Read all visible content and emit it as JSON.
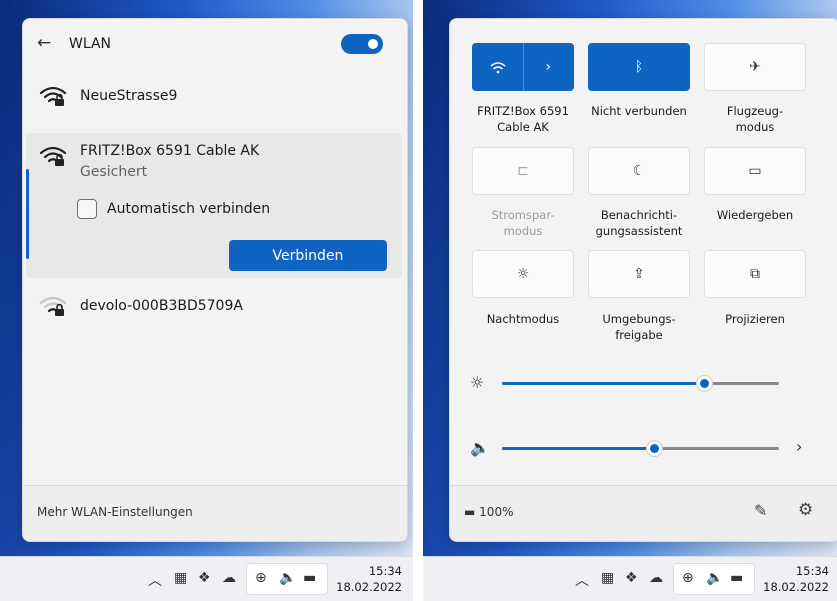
{
  "wlan": {
    "title": "WLAN",
    "back_icon": "←",
    "networks": [
      {
        "name": "NeueStrasse9",
        "status": ""
      },
      {
        "name": "FRITZ!Box 6591 Cable AK",
        "status": "Gesichert"
      },
      {
        "name": "devolo-000B3BD5709A",
        "status": ""
      }
    ],
    "auto_connect_label": "Automatisch verbinden",
    "connect_button": "Verbinden",
    "footer_link": "Mehr WLAN-Einstellungen"
  },
  "quick_settings": {
    "tiles": [
      {
        "icon": "wifi-icon",
        "label": "FRITZ!Box 6591\nCable AK",
        "state": "on"
      },
      {
        "icon": "bluetooth-icon",
        "label": "Nicht verbunden",
        "state": "on"
      },
      {
        "icon": "airplane-icon",
        "label": "Flugzeug-\nmodus",
        "state": "off"
      },
      {
        "icon": "battery-saver-icon",
        "label": "Stromspar-\nmodus",
        "state": "disabled"
      },
      {
        "icon": "moon-icon",
        "label": "Benachrichti-\ngungsassistent",
        "state": "off"
      },
      {
        "icon": "cast-icon",
        "label": "Wiedergeben",
        "state": "off"
      },
      {
        "icon": "night-light-icon",
        "label": "Nachtmodus",
        "state": "off"
      },
      {
        "icon": "share-icon",
        "label": "Umgebungs-\nfreigabe",
        "state": "off"
      },
      {
        "icon": "project-icon",
        "label": "Projizieren",
        "state": "off"
      }
    ],
    "brightness": 0.73,
    "volume": 0.55,
    "battery_text": "100%"
  },
  "taskbar": {
    "time": "15:34",
    "date": "18.02.2022"
  },
  "colors": {
    "accent": "#0f64c1",
    "panel": "#f3f3f3"
  }
}
